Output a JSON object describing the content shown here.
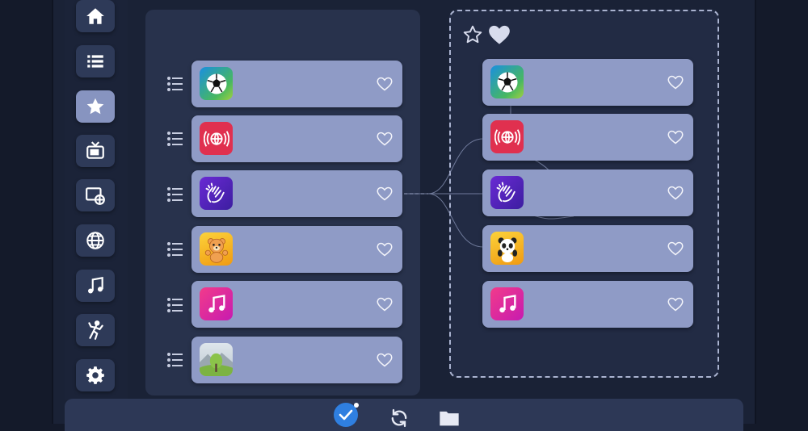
{
  "sidebar": {
    "items": [
      {
        "name": "home",
        "active": false
      },
      {
        "name": "list",
        "active": false
      },
      {
        "name": "favorites",
        "active": true
      },
      {
        "name": "tv",
        "active": false
      },
      {
        "name": "media",
        "active": false
      },
      {
        "name": "globe",
        "active": false
      },
      {
        "name": "music",
        "active": false
      },
      {
        "name": "activity",
        "active": false
      },
      {
        "name": "settings",
        "active": false
      }
    ]
  },
  "left_list": [
    {
      "icon": "soccer-ball-app-icon",
      "bg": "#1d9bd6"
    },
    {
      "icon": "broadcast-globe-app-icon",
      "bg": "#e0304f"
    },
    {
      "icon": "clapping-hands-app-icon",
      "bg": "#5b27c2"
    },
    {
      "icon": "teddy-bear-app-icon",
      "bg": "#f2a61c"
    },
    {
      "icon": "music-note-app-icon",
      "bg": "#e2259a"
    },
    {
      "icon": "tree-landscape-app-icon",
      "bg": "#c6d2da"
    }
  ],
  "right_list": [
    {
      "icon": "soccer-ball-app-icon",
      "bg": "#1d9bd6"
    },
    {
      "icon": "broadcast-globe-app-icon",
      "bg": "#e0304f"
    },
    {
      "icon": "clapping-hands-app-icon",
      "bg": "#5b27c2"
    },
    {
      "icon": "panda-app-icon",
      "bg": "#f2a61c"
    },
    {
      "icon": "music-note-app-icon",
      "bg": "#e2259a"
    }
  ],
  "colors": {
    "card": "#8f9bc6",
    "accent": "#2f7fe0",
    "panel": "#28324c"
  },
  "bottom_bar": {
    "icons": [
      "check-circle-icon",
      "sync-icon",
      "folder-icon"
    ]
  }
}
